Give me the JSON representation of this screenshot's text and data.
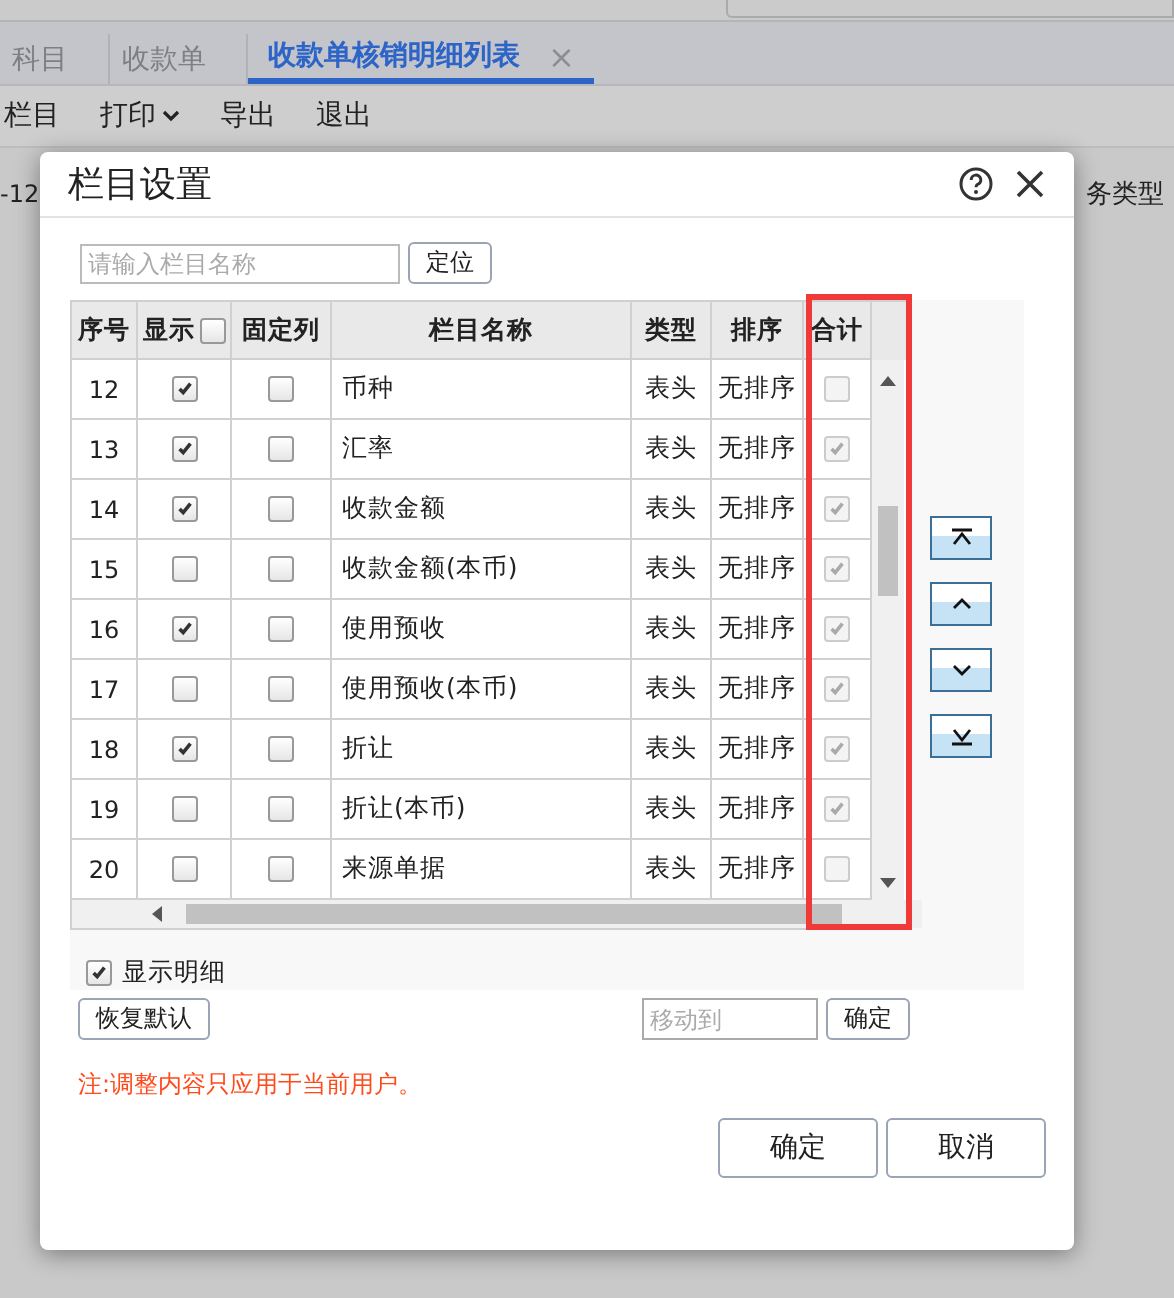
{
  "background": {
    "tabs": [
      {
        "label": "科目",
        "selected": false,
        "closable": false
      },
      {
        "label": "收款单",
        "selected": false,
        "closable": false
      },
      {
        "label": "收款单核销明细列表",
        "selected": true,
        "closable": true,
        "close": "×"
      }
    ],
    "toolbar": [
      {
        "label": "栏目",
        "dropdown": false
      },
      {
        "label": "打印",
        "dropdown": true
      },
      {
        "label": "导出",
        "dropdown": false
      },
      {
        "label": "退出",
        "dropdown": false
      }
    ],
    "left_fragment": "-12",
    "right_fragment": "务类型"
  },
  "dialog": {
    "title": "栏目设置",
    "search": {
      "placeholder": "请输入栏目名称"
    },
    "locate_button": "定位",
    "columns": [
      "序号",
      "显示",
      "固定列",
      "栏目名称",
      "类型",
      "排序",
      "合计"
    ],
    "header_show_checked": false,
    "rows": [
      {
        "no": "12",
        "show": true,
        "fixed": false,
        "name": "币种",
        "type": "表头",
        "sort": "无排序",
        "total": false
      },
      {
        "no": "13",
        "show": true,
        "fixed": false,
        "name": "汇率",
        "type": "表头",
        "sort": "无排序",
        "total": true
      },
      {
        "no": "14",
        "show": true,
        "fixed": false,
        "name": "收款金额",
        "type": "表头",
        "sort": "无排序",
        "total": true
      },
      {
        "no": "15",
        "show": false,
        "fixed": false,
        "name": "收款金额(本币)",
        "type": "表头",
        "sort": "无排序",
        "total": true
      },
      {
        "no": "16",
        "show": true,
        "fixed": false,
        "name": "使用预收",
        "type": "表头",
        "sort": "无排序",
        "total": true
      },
      {
        "no": "17",
        "show": false,
        "fixed": false,
        "name": "使用预收(本币)",
        "type": "表头",
        "sort": "无排序",
        "total": true
      },
      {
        "no": "18",
        "show": true,
        "fixed": false,
        "name": "折让",
        "type": "表头",
        "sort": "无排序",
        "total": true
      },
      {
        "no": "19",
        "show": false,
        "fixed": false,
        "name": "折让(本币)",
        "type": "表头",
        "sort": "无排序",
        "total": true
      },
      {
        "no": "20",
        "show": false,
        "fixed": false,
        "name": "来源单据",
        "type": "表头",
        "sort": "无排序",
        "total": false
      }
    ],
    "show_detail": {
      "label": "显示明细",
      "checked": true
    },
    "restore_button": "恢复默认",
    "move_to": {
      "placeholder": "移动到"
    },
    "move_button": "确定",
    "note": "注:调整内容只应用于当前用户。",
    "buttons": [
      "确定",
      "取消"
    ]
  }
}
